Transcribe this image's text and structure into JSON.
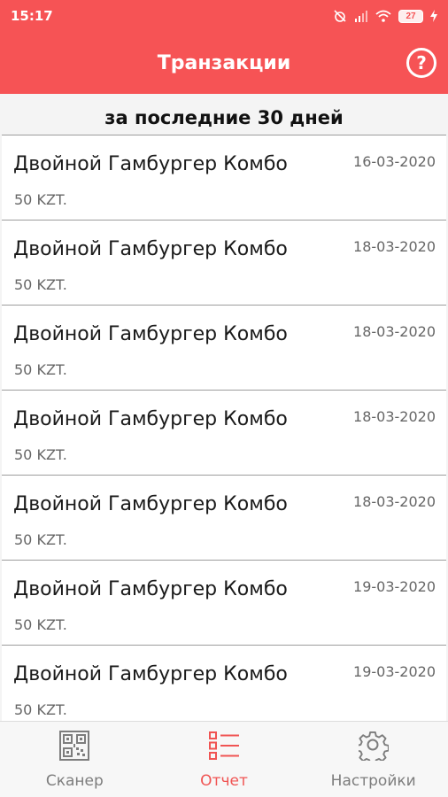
{
  "status_bar": {
    "time": "15:17",
    "battery": "27",
    "icons": [
      "alarm-off-icon",
      "signal-icon",
      "wifi-icon",
      "battery-icon",
      "charging-icon"
    ]
  },
  "app_bar": {
    "title": "Транзакции",
    "help_label": "?"
  },
  "section_title": "за последние 30 дней",
  "transactions": [
    {
      "name": "Двойной Гамбургер Комбо",
      "price": "50 KZT.",
      "date": "16-03-2020"
    },
    {
      "name": "Двойной Гамбургер Комбо",
      "price": "50 KZT.",
      "date": "18-03-2020"
    },
    {
      "name": "Двойной Гамбургер Комбо",
      "price": "50 KZT.",
      "date": "18-03-2020"
    },
    {
      "name": "Двойной Гамбургер Комбо",
      "price": "50 KZT.",
      "date": "18-03-2020"
    },
    {
      "name": "Двойной Гамбургер Комбо",
      "price": "50 KZT.",
      "date": "18-03-2020"
    },
    {
      "name": "Двойной Гамбургер Комбо",
      "price": "50 KZT.",
      "date": "19-03-2020"
    },
    {
      "name": "Двойной Гамбургер Комбо",
      "price": "50 KZT.",
      "date": "19-03-2020"
    }
  ],
  "bottom_nav": {
    "items": [
      {
        "label": "Сканер",
        "icon": "qr-code-icon",
        "active": false
      },
      {
        "label": "Отчет",
        "icon": "list-icon",
        "active": true
      },
      {
        "label": "Настройки",
        "icon": "gear-icon",
        "active": false
      }
    ]
  },
  "colors": {
    "primary": "#f65355",
    "active_nav": "#f05453",
    "inactive_nav": "#7d7d7d"
  }
}
